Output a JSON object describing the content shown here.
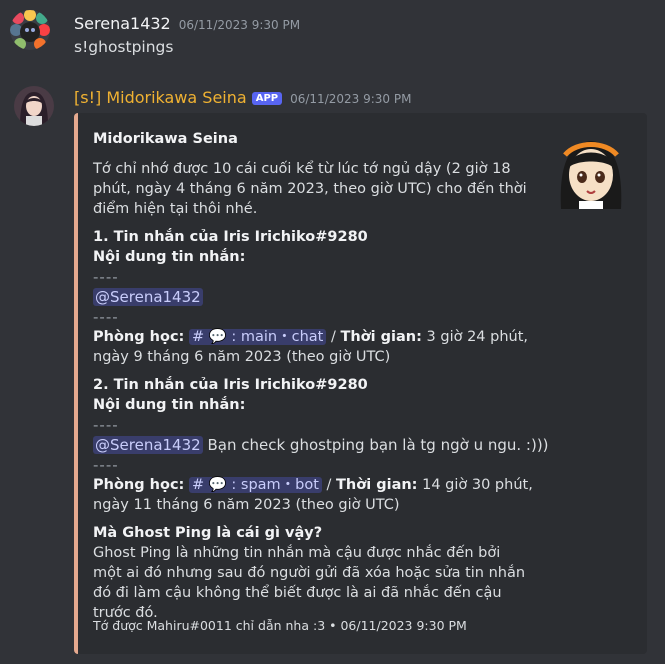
{
  "message1": {
    "username": "Serena1432",
    "timestamp": "06/11/2023 9:30 PM",
    "content": "s!ghostpings"
  },
  "message2": {
    "username": "[s!] Midorikawa Seina",
    "badge": "APP",
    "timestamp": "06/11/2023 9:30 PM",
    "embed": {
      "accent_color": "#e5a98f",
      "author": "Midorikawa Seina",
      "description": "Tớ chỉ nhớ được 10 cái cuối kể từ lúc tớ ngủ dậy (2 giờ 18 phút, ngày 4 tháng 6 năm 2023, theo giờ UTC) cho đến thời điểm hiện tại thôi nhé.",
      "fields": [
        {
          "name": "1. Tin nhắn của Iris Irichiko#9280",
          "content_label": "Nội dung tin nhắn:",
          "separator": "----",
          "mention": "@Serena1432",
          "text": "",
          "room_label": "Phòng học:",
          "channel": "main・chat",
          "time_label": "Thời gian:",
          "time_value": "3 giờ 24 phút, ngày 9 tháng 6 năm 2023 (theo giờ UTC)"
        },
        {
          "name": "2. Tin nhắn của Iris Irichiko#9280",
          "content_label": "Nội dung tin nhắn:",
          "separator": "----",
          "mention": "@Serena1432",
          "text": "Bạn check ghostping bạn là tg ngờ u ngu. :)))",
          "room_label": "Phòng học:",
          "channel": "spam・bot",
          "time_label": "Thời gian:",
          "time_value": "14 giờ 30 phút, ngày 11 tháng 6 năm 2023 (theo giờ UTC)"
        },
        {
          "name": "Mà Ghost Ping là cái gì vậy?",
          "value": "Ghost Ping là những tin nhắn mà cậu được nhắc đến bởi một ai đó nhưng sau đó người gửi đã xóa hoặc sửa tin nhắn đó đi làm cậu không thể biết được là ai đã nhắc đến cậu trước đó."
        }
      ],
      "footer": "Tớ được Mahiru#0011 chỉ dẫn nha :3 • 06/11/2023 9:30 PM"
    }
  },
  "colors": {
    "username1": "#f2f3f5",
    "username2": "#f0b232",
    "badge": "#5865f2",
    "background": "#313338",
    "embed_bg": "#2b2d31"
  }
}
